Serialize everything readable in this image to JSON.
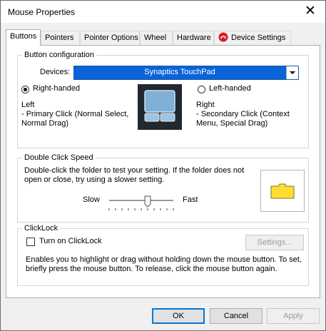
{
  "window": {
    "title": "Mouse Properties",
    "close_glyph": "✕"
  },
  "tabs": [
    {
      "label": "Buttons"
    },
    {
      "label": "Pointers"
    },
    {
      "label": "Pointer Options"
    },
    {
      "label": "Wheel"
    },
    {
      "label": "Hardware"
    },
    {
      "label": "Device Settings",
      "icon": "synaptics-icon",
      "icon_color": "#d21f26"
    }
  ],
  "button_config": {
    "legend": "Button configuration",
    "devices_label": "Devices:",
    "device_value": "Synaptics TouchPad",
    "right_handed": {
      "label": "Right-handed",
      "checked": true
    },
    "left_handed": {
      "label": "Left-handed",
      "checked": false
    },
    "left_desc": [
      "Left",
      " - Primary Click (Normal Select,",
      "Normal Drag)"
    ],
    "right_desc": [
      "Right",
      " - Secondary Click (Context",
      "Menu, Special Drag)"
    ],
    "touchpad_image": "touchpad-icon"
  },
  "double_click": {
    "legend": "Double Click Speed",
    "instructions": [
      "Double-click the folder to test your setting.  If the folder does not",
      "open or close, try using a slower setting."
    ],
    "slow_label": "Slow",
    "fast_label": "Fast",
    "speed_level": 0.6,
    "folder_icon": "folder-icon"
  },
  "clicklock": {
    "legend": "ClickLock",
    "checkbox_label": "Turn on ClickLock",
    "checked": false,
    "settings_label": "Settings...",
    "description": [
      "Enables you to highlight or drag without holding down the mouse button.  To set,",
      "briefly press the mouse button.  To release, click the mouse button again."
    ]
  },
  "footer": {
    "ok_label": "OK",
    "cancel_label": "Cancel",
    "apply_label": "Apply"
  },
  "colors": {
    "selection_blue": "#0a64d8",
    "folder_yellow": "#ffdd33",
    "accent": "#0078d7"
  }
}
